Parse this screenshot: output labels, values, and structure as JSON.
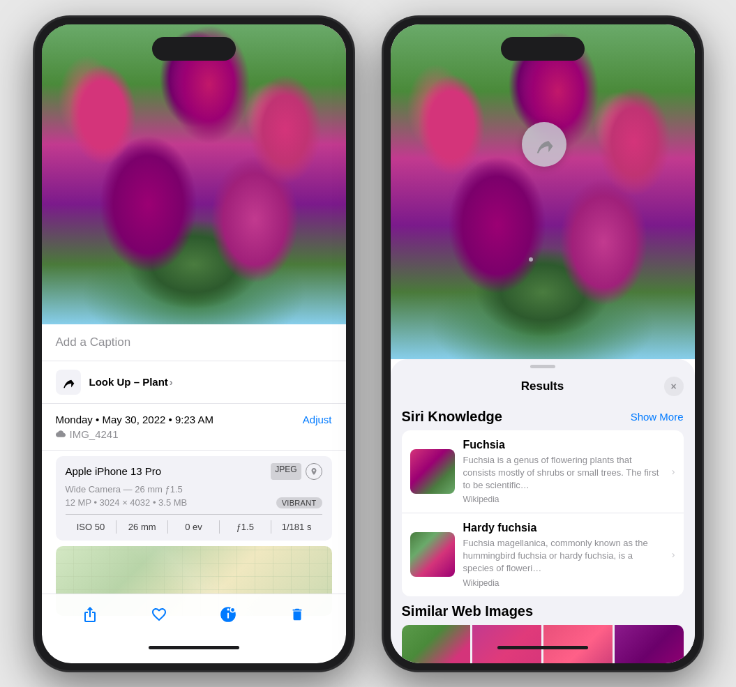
{
  "left_phone": {
    "caption_placeholder": "Add a Caption",
    "look_up": {
      "prefix": "Look Up – ",
      "subject": "Plant",
      "chevron": "›"
    },
    "metadata": {
      "date": "Monday • May 30, 2022 • 9:23 AM",
      "adjust_label": "Adjust",
      "cloud_filename": "IMG_4241"
    },
    "device": {
      "name": "Apple iPhone 13 Pro",
      "format_badge": "JPEG",
      "camera": "Wide Camera — 26 mm ƒ1.5",
      "resolution": "12 MP  •  3024 × 4032  •  3.5 MB",
      "style_badge": "VIBRANT"
    },
    "exif": {
      "iso": "ISO 50",
      "focal": "26 mm",
      "ev": "0 ev",
      "aperture": "ƒ1.5",
      "shutter": "1/181 s"
    },
    "toolbar": {
      "share_label": "Share",
      "like_label": "Like",
      "info_label": "Info",
      "delete_label": "Delete"
    }
  },
  "right_phone": {
    "results_title": "Results",
    "close_label": "×",
    "siri_knowledge": {
      "section_title": "Siri Knowledge",
      "show_more": "Show More",
      "items": [
        {
          "title": "Fuchsia",
          "description": "Fuchsia is a genus of flowering plants that consists mostly of shrubs or small trees. The first to be scientific…",
          "source": "Wikipedia"
        },
        {
          "title": "Hardy fuchsia",
          "description": "Fuchsia magellanica, commonly known as the hummingbird fuchsia or hardy fuchsia, is a species of floweri…",
          "source": "Wikipedia"
        }
      ]
    },
    "similar_web": {
      "section_title": "Similar Web Images"
    }
  }
}
